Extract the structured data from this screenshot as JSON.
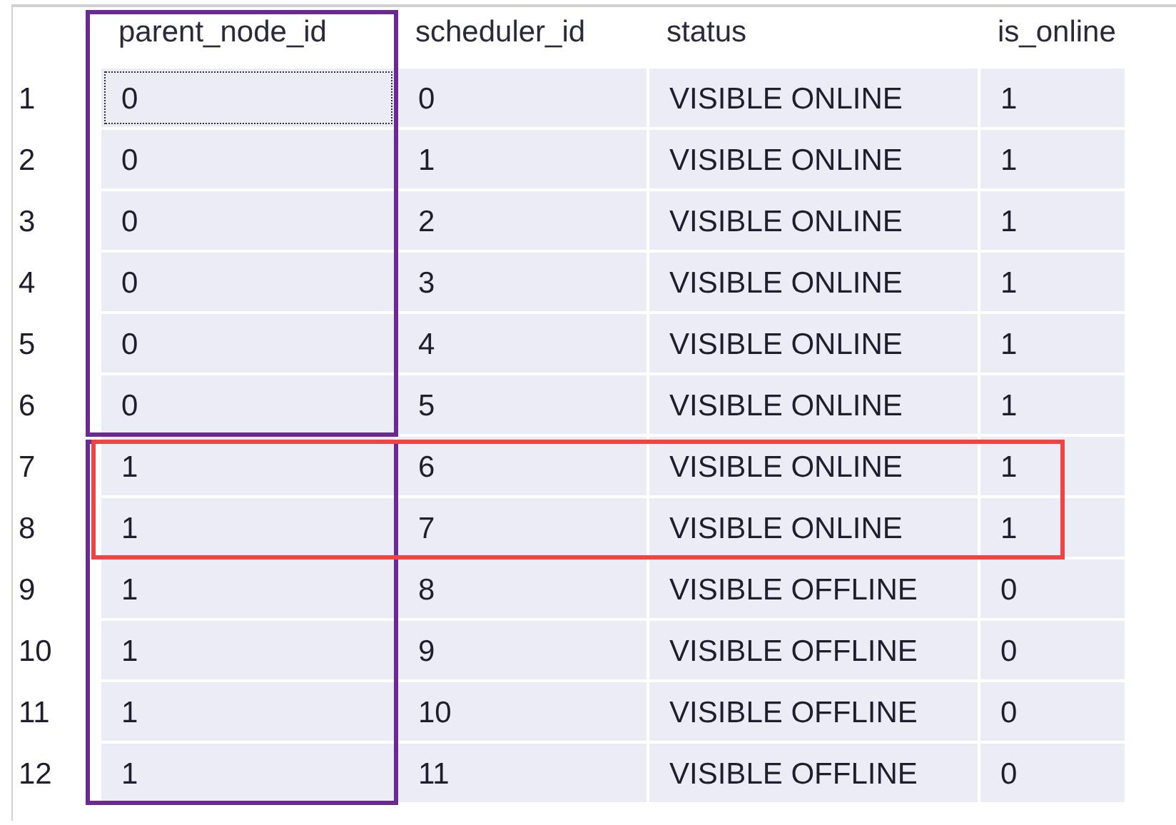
{
  "table": {
    "columns": [
      "parent_node_id",
      "scheduler_id",
      "status",
      "is_online"
    ],
    "rows": [
      {
        "number": "1",
        "cells": [
          "0",
          "0",
          "VISIBLE ONLINE",
          "1"
        ],
        "focused": true,
        "group_start": true,
        "highlighted": false
      },
      {
        "number": "2",
        "cells": [
          "0",
          "1",
          "VISIBLE ONLINE",
          "1"
        ],
        "focused": false,
        "group_start": false,
        "highlighted": false
      },
      {
        "number": "3",
        "cells": [
          "0",
          "2",
          "VISIBLE ONLINE",
          "1"
        ],
        "focused": false,
        "group_start": false,
        "highlighted": false
      },
      {
        "number": "4",
        "cells": [
          "0",
          "3",
          "VISIBLE ONLINE",
          "1"
        ],
        "focused": false,
        "group_start": false,
        "highlighted": false
      },
      {
        "number": "5",
        "cells": [
          "0",
          "4",
          "VISIBLE ONLINE",
          "1"
        ],
        "focused": false,
        "group_start": false,
        "highlighted": false
      },
      {
        "number": "6",
        "cells": [
          "0",
          "5",
          "VISIBLE ONLINE",
          "1"
        ],
        "focused": false,
        "group_start": false,
        "highlighted": false
      },
      {
        "number": "7",
        "cells": [
          "1",
          "6",
          "VISIBLE ONLINE",
          "1"
        ],
        "focused": false,
        "group_start": true,
        "highlighted": true
      },
      {
        "number": "8",
        "cells": [
          "1",
          "7",
          "VISIBLE ONLINE",
          "1"
        ],
        "focused": false,
        "group_start": false,
        "highlighted": true
      },
      {
        "number": "9",
        "cells": [
          "1",
          "8",
          "VISIBLE OFFLINE",
          "0"
        ],
        "focused": false,
        "group_start": false,
        "highlighted": false
      },
      {
        "number": "10",
        "cells": [
          "1",
          "9",
          "VISIBLE OFFLINE",
          "0"
        ],
        "focused": false,
        "group_start": false,
        "highlighted": false
      },
      {
        "number": "11",
        "cells": [
          "1",
          "10",
          "VISIBLE OFFLINE",
          "0"
        ],
        "focused": false,
        "group_start": false,
        "highlighted": false
      },
      {
        "number": "12",
        "cells": [
          "1",
          "11",
          "VISIBLE OFFLINE",
          "0"
        ],
        "focused": false,
        "group_start": false,
        "highlighted": false
      }
    ]
  }
}
